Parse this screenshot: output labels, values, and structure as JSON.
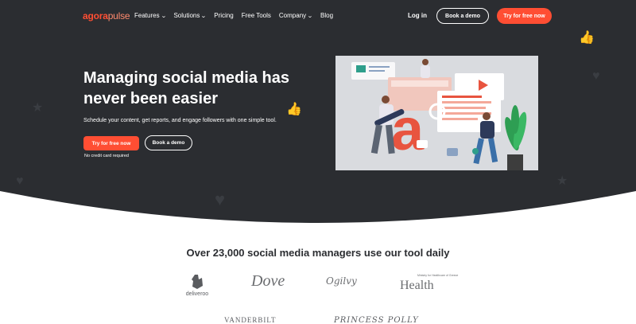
{
  "nav": {
    "logo_primary": "agora",
    "logo_secondary": "pulse",
    "links": [
      {
        "label": "Features",
        "has_dropdown": true
      },
      {
        "label": "Solutions",
        "has_dropdown": true
      },
      {
        "label": "Pricing",
        "has_dropdown": false
      },
      {
        "label": "Free Tools",
        "has_dropdown": false
      },
      {
        "label": "Company",
        "has_dropdown": true
      },
      {
        "label": "Blog",
        "has_dropdown": false
      }
    ],
    "login": "Log in",
    "book_demo": "Book a demo",
    "try_free": "Try for free now"
  },
  "hero": {
    "headline": "Managing social media has never been easier",
    "subtext": "Schedule your content, get reports, and engage followers with one simple tool.",
    "cta_primary": "Try for free now",
    "cta_secondary": "Book a demo",
    "note": "No credit card required"
  },
  "social_proof": {
    "heading": "Over 23,000 social media managers use our tool daily",
    "logos": [
      "deliveroo",
      "Dove",
      "Ogilvy",
      "Health",
      "VANDERBILT",
      "PRINCESS POLLY"
    ],
    "health_small": "Ministry for Healthcare of Greece"
  },
  "colors": {
    "hero_bg": "#2b2d31",
    "accent": "#ff4e33",
    "text_light": "#ffffff"
  }
}
